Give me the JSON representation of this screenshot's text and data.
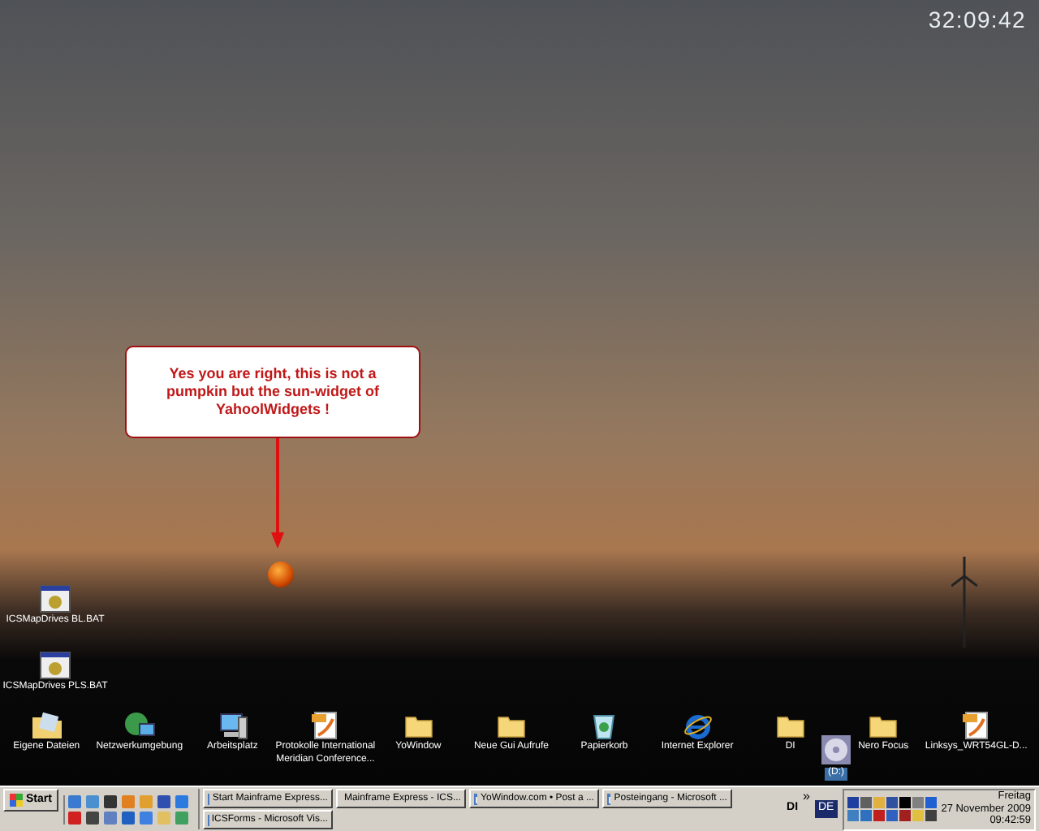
{
  "clock_widget": {
    "time": "32:09:42"
  },
  "callout": {
    "text": "Yes you are right, this is not a pumpkin but the sun-widget of YahoolWidgets !"
  },
  "desktop_icons_left": [
    {
      "label": "ICSMapDrives BL.BAT",
      "kind": "bat",
      "selected": false
    },
    {
      "label": "ICSMapDrives PLS.BAT",
      "kind": "bat",
      "selected": false
    }
  ],
  "desktop_icons_bottom": [
    {
      "label": "Eigene Dateien",
      "kind": "docs",
      "selected": false
    },
    {
      "label": "Netzwerkumgebung",
      "kind": "network",
      "selected": false
    },
    {
      "label": "Arbeitsplatz",
      "kind": "computer",
      "selected": false
    },
    {
      "label": "Protokolle International Meridian Conference...",
      "kind": "pdf",
      "selected": false
    },
    {
      "label": "YoWindow",
      "kind": "folder",
      "selected": false
    },
    {
      "label": "Neue Gui Aufrufe",
      "kind": "folder",
      "selected": false
    },
    {
      "label": "Papierkorb",
      "kind": "recycle",
      "selected": false
    },
    {
      "label": "Internet Explorer",
      "kind": "ie",
      "selected": false
    },
    {
      "label": "DI",
      "kind": "folder",
      "selected": false
    },
    {
      "label": "Nero Focus",
      "kind": "folder",
      "selected": false
    },
    {
      "label": "Linksys_WRT54GL-D...",
      "kind": "pdf",
      "selected": false
    }
  ],
  "drive_icon": {
    "label": "(D:)",
    "kind": "cd",
    "selected": true
  },
  "taskbar": {
    "start": "Start",
    "tasks_row1": [
      {
        "label": "Start Mainframe Express..."
      },
      {
        "label": "Mainframe Express - ICS..."
      },
      {
        "label": "YoWindow.com • Post a ..."
      },
      {
        "label": "Posteingang - Microsoft ..."
      }
    ],
    "tasks_row2": [
      {
        "label": "ICSForms - Microsoft Vis..."
      }
    ],
    "toolbar_label": "DI",
    "chevron": "»",
    "language": "DE",
    "clock": {
      "day": "Freitag",
      "date": "27 November 2009",
      "time": "09:42:59"
    }
  }
}
